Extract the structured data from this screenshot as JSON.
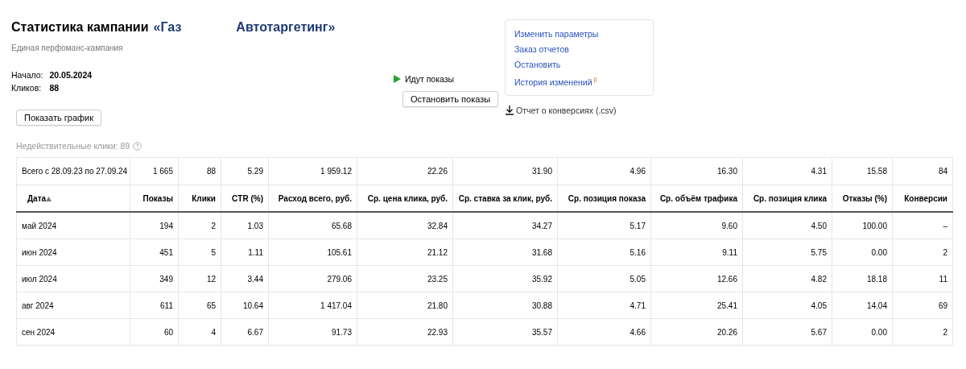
{
  "header": {
    "title": "Статистика кампании",
    "campaign_name_start": "«Газ",
    "campaign_name_end": "Автотаргетинг»",
    "subtitle": "Единая перфоманс-кампания",
    "facts": [
      {
        "label": "Начало:",
        "value": "20.05.2024"
      },
      {
        "label": "Кликов:",
        "value": "88"
      }
    ],
    "show_chart_button": "Показать график",
    "invalid_clicks": "Недействительные клики: 89"
  },
  "status": {
    "text": "Идут показы",
    "running": true,
    "stop_button": "Остановить показы"
  },
  "actions": {
    "links": [
      {
        "label": "Изменить параметры"
      },
      {
        "label": "Заказ отчетов"
      },
      {
        "label": "Остановить"
      },
      {
        "label": "История изменений",
        "badge": "β"
      }
    ],
    "download": "Отчет о конверсиях (.csv)"
  },
  "table": {
    "total": [
      "Всего с 28.09.23 по 27.09.24",
      "1 665",
      "88",
      "5.29",
      "1 959.12",
      "22.26",
      "31.90",
      "4.96",
      "16.30",
      "4.31",
      "15.58",
      "84"
    ],
    "columns": [
      {
        "label": "Дата",
        "sorted_ascending": true
      },
      {
        "label": "Показы"
      },
      {
        "label": "Клики"
      },
      {
        "label": "CTR (%)"
      },
      {
        "label": "Расход всего, руб."
      },
      {
        "label": "Ср. цена клика, руб."
      },
      {
        "label": "Ср. ставка за клик, руб."
      },
      {
        "label": "Ср. позиция показа"
      },
      {
        "label": "Ср. объём трафика"
      },
      {
        "label": "Ср. позиция клика"
      },
      {
        "label": "Отказы (%)"
      },
      {
        "label": "Конверсии"
      }
    ],
    "rows": [
      [
        "май 2024",
        "194",
        "2",
        "1.03",
        "65.68",
        "32.84",
        "34.27",
        "5.17",
        "9.60",
        "4.50",
        "100.00",
        "–"
      ],
      [
        "июн 2024",
        "451",
        "5",
        "1.11",
        "105.61",
        "21.12",
        "31.68",
        "5.16",
        "9.11",
        "5.75",
        "0.00",
        "2"
      ],
      [
        "июл 2024",
        "349",
        "12",
        "3.44",
        "279.06",
        "23.25",
        "35.92",
        "5.05",
        "12.66",
        "4.82",
        "18.18",
        "11"
      ],
      [
        "авг 2024",
        "611",
        "65",
        "10.64",
        "1 417.04",
        "21.80",
        "30.88",
        "4.71",
        "25.41",
        "4.05",
        "14.04",
        "69"
      ],
      [
        "сен 2024",
        "60",
        "4",
        "6.67",
        "91.73",
        "22.93",
        "35.57",
        "4.66",
        "20.26",
        "5.67",
        "0.00",
        "2"
      ]
    ]
  }
}
